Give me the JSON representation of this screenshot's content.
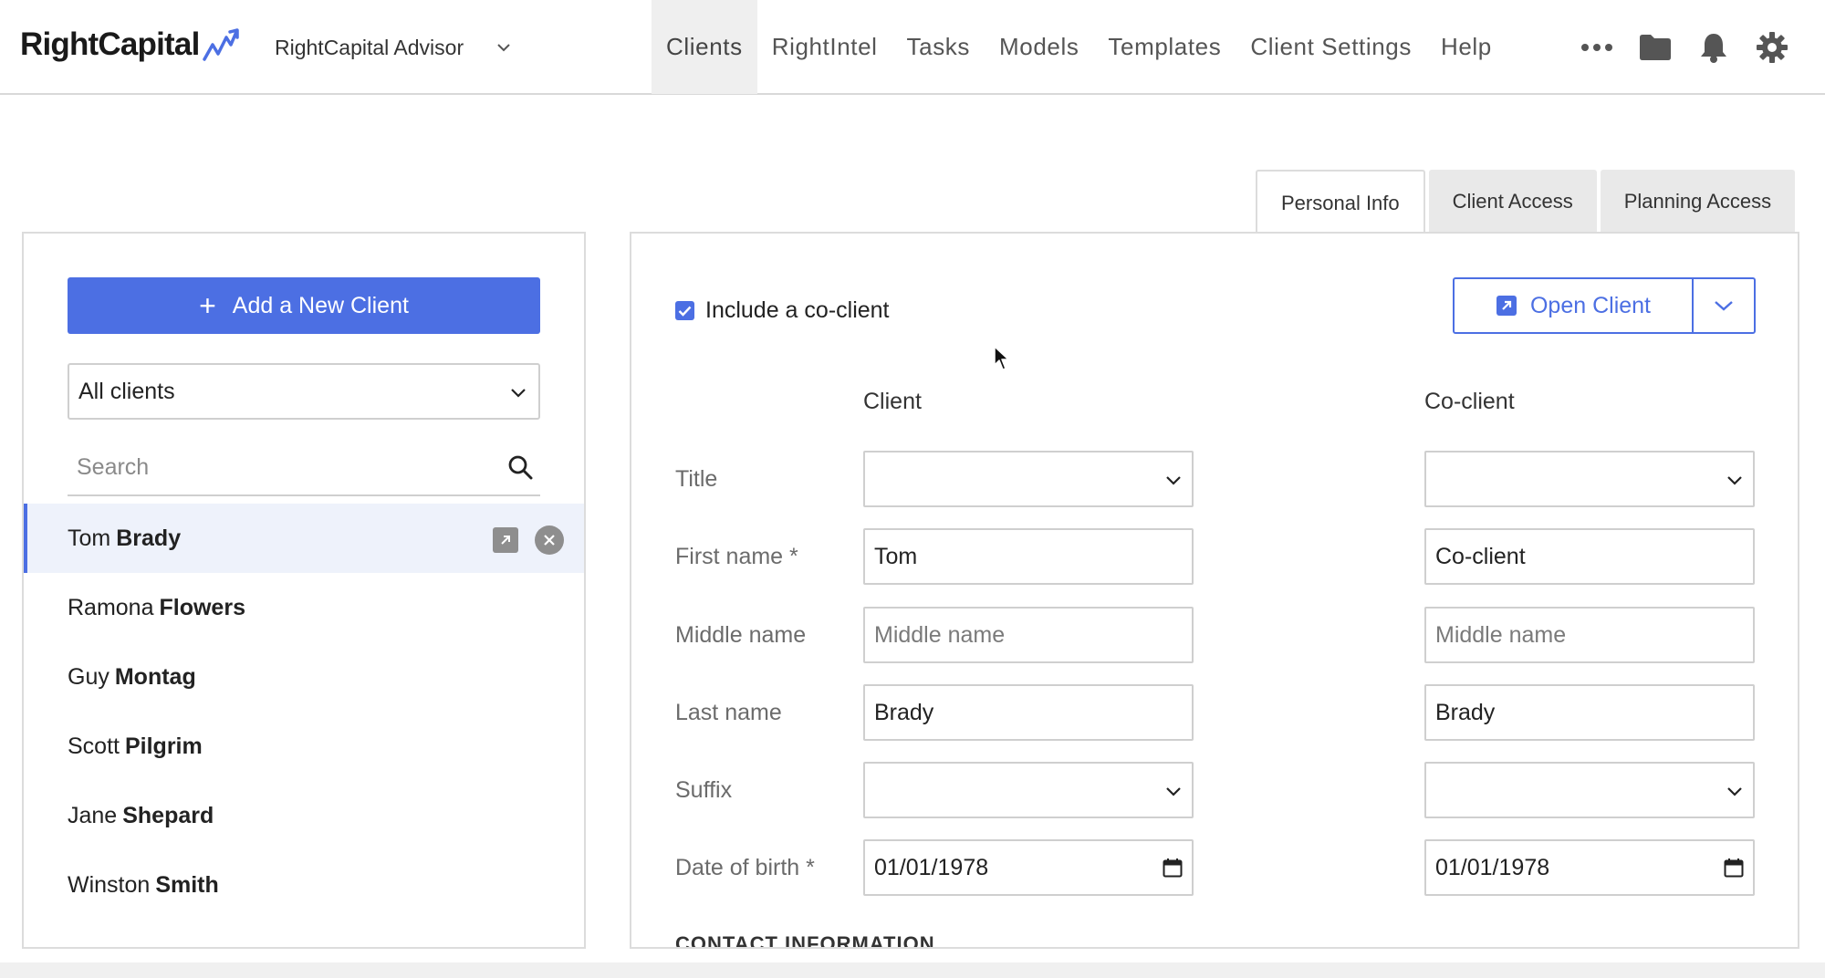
{
  "brand": {
    "name": "RightCapital",
    "accent": "#4c6fe3"
  },
  "account": {
    "name": "RightCapital Advisor"
  },
  "nav": {
    "items": [
      "Clients",
      "RightIntel",
      "Tasks",
      "Models",
      "Templates",
      "Client Settings",
      "Help"
    ],
    "active": "Clients",
    "icons": [
      "more-icon",
      "folder-icon",
      "bell-icon",
      "gear-icon"
    ]
  },
  "sidebar": {
    "add_button": "Add a New Client",
    "filter": "All clients",
    "search_placeholder": "Search",
    "clients": [
      {
        "first": "Tom",
        "last": "Brady",
        "selected": true
      },
      {
        "first": "Ramona",
        "last": "Flowers"
      },
      {
        "first": "Guy",
        "last": "Montag"
      },
      {
        "first": "Scott",
        "last": "Pilgrim"
      },
      {
        "first": "Jane",
        "last": "Shepard"
      },
      {
        "first": "Winston",
        "last": "Smith"
      }
    ]
  },
  "tabs": [
    {
      "label": "Personal Info",
      "active": true
    },
    {
      "label": "Client Access"
    },
    {
      "label": "Planning Access"
    }
  ],
  "form": {
    "include_coclient_label": "Include a co-client",
    "include_coclient": true,
    "open_client_label": "Open Client",
    "col_client": "Client",
    "col_coclient": "Co-client",
    "labels": {
      "title": "Title",
      "first_name": "First name *",
      "middle_name": "Middle name",
      "last_name": "Last name",
      "suffix": "Suffix",
      "dob": "Date of birth *"
    },
    "client": {
      "title": "",
      "first_name": "Tom",
      "middle_placeholder": "Middle name",
      "last_name": "Brady",
      "suffix": "",
      "dob": "01/01/1978"
    },
    "coclient": {
      "title": "",
      "first_name": "Co-client",
      "middle_placeholder": "Middle name",
      "last_name": "Brady",
      "suffix": "",
      "dob": "01/01/1978"
    },
    "section_contact": "CONTACT INFORMATION"
  }
}
